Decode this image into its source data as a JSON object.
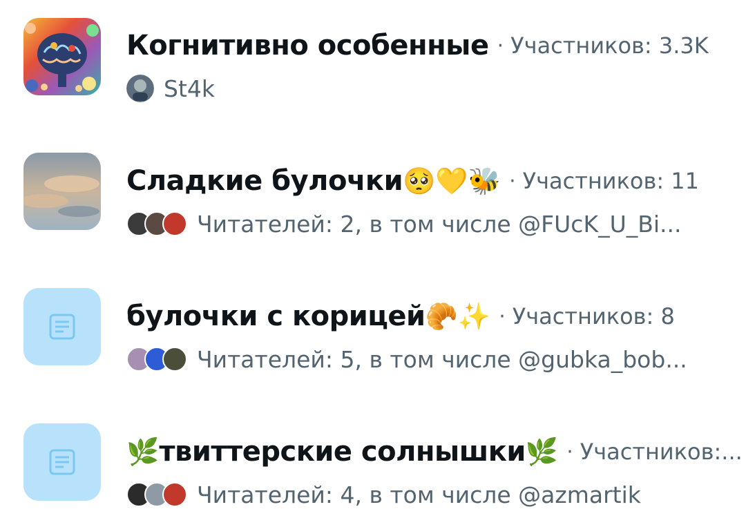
{
  "communities": [
    {
      "name": "Когнитивно особенные",
      "emoji": "",
      "members_text": "Участников: 3.3K",
      "owner": "St4k",
      "readers_text": ""
    },
    {
      "name": "Сладкие булочки",
      "emoji": "🥺💛🐝",
      "members_text": "Участников: 11",
      "readers_text": "Читателей: 2, в том числе @FUcK_U_Bi..."
    },
    {
      "name": "булочки с корицей",
      "emoji": "🥐✨",
      "members_text": "Участников: 8",
      "readers_text": "Читателей: 5, в том числе @gubka_bob..."
    },
    {
      "name": "твиттерские солнышки",
      "emoji_prefix": "🌿",
      "emoji": "🌿",
      "members_text": "Участников:...",
      "readers_text": "Читателей: 4, в том числе @azmartik"
    }
  ],
  "separator": "·",
  "icons": {
    "placeholder": "document-icon"
  },
  "colors": {
    "placeholder_bg": "#b8e2fb",
    "placeholder_icon": "#7cc6f2",
    "secondary_text": "#536471"
  }
}
